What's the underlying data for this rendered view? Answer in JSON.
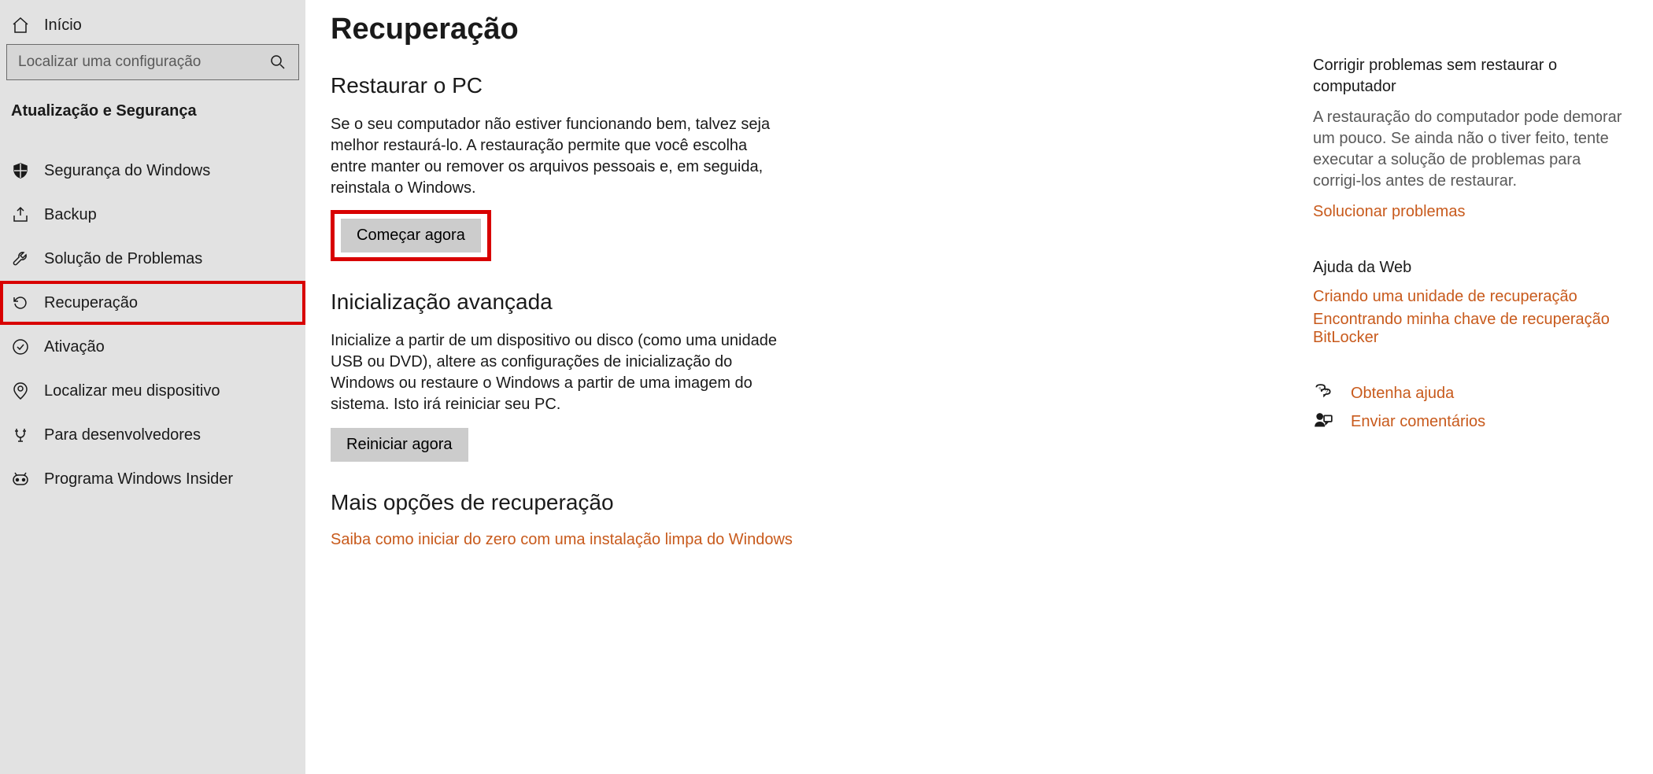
{
  "sidebar": {
    "home_label": "Início",
    "search_placeholder": "Localizar uma configuração",
    "category_title": "Atualização e Segurança",
    "nav": [
      {
        "key": "security",
        "label": "Segurança do Windows"
      },
      {
        "key": "backup",
        "label": "Backup"
      },
      {
        "key": "troublesh",
        "label": "Solução de Problemas"
      },
      {
        "key": "recovery",
        "label": "Recuperação"
      },
      {
        "key": "activation",
        "label": "Ativação"
      },
      {
        "key": "findmy",
        "label": "Localizar meu dispositivo"
      },
      {
        "key": "dev",
        "label": "Para desenvolvedores"
      },
      {
        "key": "insider",
        "label": "Programa Windows Insider"
      }
    ]
  },
  "main": {
    "page_title": "Recuperação",
    "reset": {
      "title": "Restaurar o PC",
      "body": "Se o seu computador não estiver funcionando bem, talvez seja melhor restaurá-lo. A restauração permite que você escolha entre manter ou remover os arquivos pessoais e, em seguida, reinstala o Windows.",
      "button": "Começar agora"
    },
    "advanced": {
      "title": "Inicialização avançada",
      "body": "Inicialize a partir de um dispositivo ou disco (como uma unidade USB ou DVD), altere as configurações de inicialização do Windows ou restaure o Windows a partir de uma imagem do sistema. Isto irá reiniciar seu PC.",
      "button": "Reiniciar agora"
    },
    "more": {
      "title": "Mais opções de recuperação",
      "link": "Saiba como iniciar do zero com uma instalação limpa do Windows"
    }
  },
  "right": {
    "fix": {
      "title": "Corrigir problemas sem restaurar o computador",
      "body": "A restauração do computador pode demorar um pouco. Se ainda não o tiver feito, tente executar a solução de problemas para corrigi-los antes de restaurar.",
      "link": "Solucionar problemas"
    },
    "webhelp": {
      "title": "Ajuda da Web",
      "links": [
        "Criando uma unidade de recuperação",
        "Encontrando minha chave de recuperação BitLocker"
      ]
    },
    "actions": {
      "help": "Obtenha ajuda",
      "feedback": "Enviar comentários"
    }
  }
}
